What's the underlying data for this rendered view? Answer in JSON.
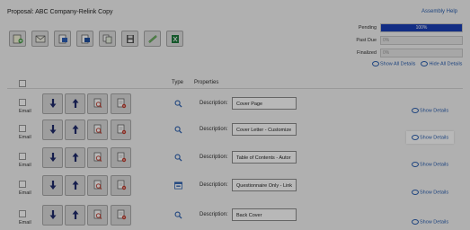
{
  "header": {
    "title": "Proposal: ABC Company-Relink Copy",
    "assembly_help": "Assembly Help"
  },
  "toolbar": {
    "buttons": [
      "add-document-icon",
      "email-icon",
      "export-word-icon",
      "export-doc-icon",
      "copy-icon",
      "save-icon",
      "link-icon",
      "excel-icon"
    ]
  },
  "status": {
    "pending_label": "Pending",
    "pending_value": "100%",
    "pending_fraction": 1.0,
    "past_due_label": "Past Due",
    "past_due_value": "0%",
    "past_due_fraction": 0,
    "finalized_label": "Finalized",
    "finalized_value": "0%",
    "finalized_fraction": 0,
    "bar_color": "#1a3fb8"
  },
  "links": {
    "show_all_details": "Show All Details",
    "hide_all_details": "Hide All Details"
  },
  "table": {
    "col_type": "Type",
    "col_properties": "Properties",
    "rows": [
      {
        "email_label": "Email",
        "desc_label": "Description:",
        "desc_value": "Cover Page",
        "type_icon": "search-icon",
        "show_details": "Show Details"
      },
      {
        "email_label": "Email",
        "desc_label": "Description:",
        "desc_value": "Cover Letter - Customize",
        "type_icon": "search-icon",
        "show_details": "Show Details"
      },
      {
        "email_label": "Email",
        "desc_label": "Description:",
        "desc_value": "Table of Contents - Autor",
        "type_icon": "search-icon",
        "show_details": "Show Details"
      },
      {
        "email_label": "Email",
        "desc_label": "Description:",
        "desc_value": "Questionnaire Only - Link",
        "type_icon": "form-icon",
        "show_details": "Show Details"
      },
      {
        "email_label": "Email",
        "desc_label": "Description:",
        "desc_value": "Back Cover",
        "type_icon": "search-icon",
        "show_details": "Show Details"
      }
    ]
  }
}
